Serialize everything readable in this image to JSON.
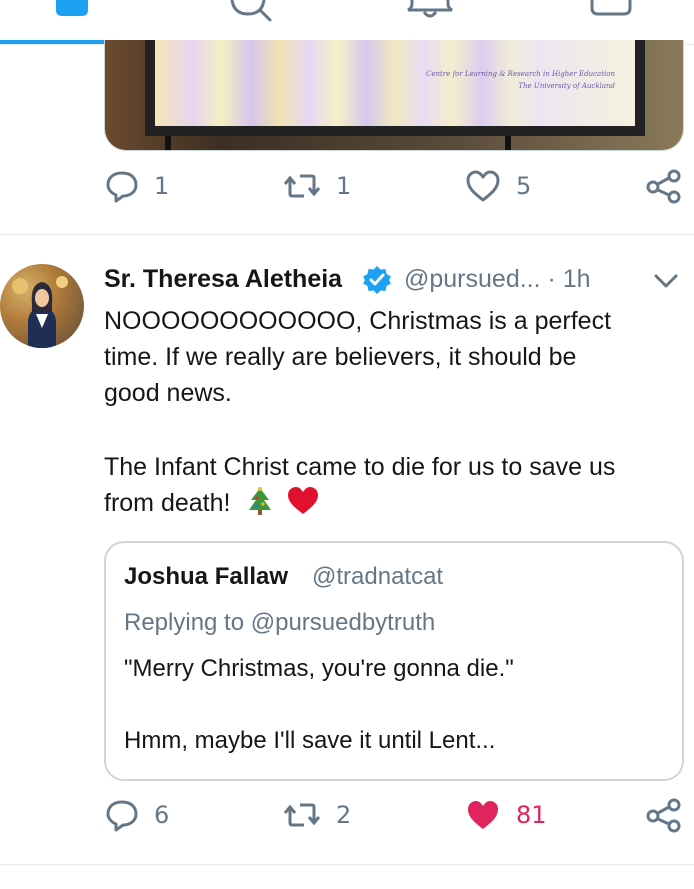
{
  "nav": {
    "tabs": [
      {
        "icon": "home-icon",
        "active": true
      },
      {
        "icon": "search-icon",
        "active": false
      },
      {
        "icon": "bell-icon",
        "active": false
      },
      {
        "icon": "mail-icon",
        "active": false
      }
    ],
    "accent": "#1da1f2"
  },
  "prev_tweet": {
    "media": {
      "line1": "Centre for Learning & Research in Higher Education",
      "line2": "The University of Auckland"
    },
    "actions": {
      "replies": "1",
      "retweets": "1",
      "likes": "5"
    }
  },
  "tweet": {
    "author_name": "Sr. Theresa Aletheia",
    "verified": true,
    "handle": "@pursued...",
    "time": " · 1h",
    "text_lines": [
      "NOOOOOOOOOOOO, Christmas is a perfect",
      "time. If we really are believers, it should be",
      "good news.",
      "The Infant Christ came to die for us to save us",
      "from death!"
    ],
    "emoji": "🎄❤️",
    "quote": {
      "author_name": "Joshua Fallaw",
      "handle": "@tradnatcat",
      "reply_to": "Replying to @pursuedbytruth",
      "text_line1": "\"Merry Christmas, you're gonna die.\"",
      "text_line2": "Hmm, maybe I'll save it until Lent..."
    },
    "actions": {
      "replies": "6",
      "retweets": "2",
      "likes": "81",
      "liked": true
    },
    "colors": {
      "like": "#e0245e",
      "muted": "#657786",
      "verified": "#1da1f2"
    }
  }
}
